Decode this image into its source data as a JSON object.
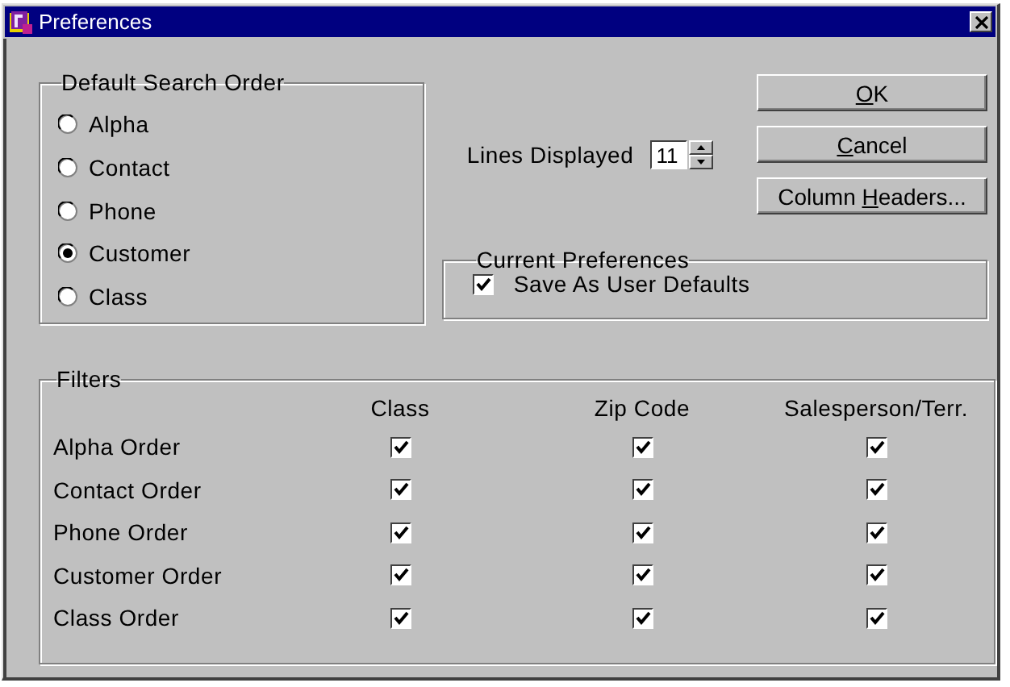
{
  "window": {
    "title": "Preferences"
  },
  "search_order": {
    "label": "Default Search Order",
    "options": [
      {
        "label": "Alpha",
        "selected": false
      },
      {
        "label": "Contact",
        "selected": false
      },
      {
        "label": "Phone",
        "selected": false
      },
      {
        "label": "Customer",
        "selected": true
      },
      {
        "label": "Class",
        "selected": false
      }
    ]
  },
  "lines_displayed": {
    "label": "Lines Displayed",
    "value": "11"
  },
  "buttons": [
    {
      "access_key": "O",
      "text_after": "K"
    },
    {
      "access_key": "C",
      "text_after": "ancel"
    },
    {
      "text_before": "Column ",
      "access_key": "H",
      "text_after": "eaders..."
    }
  ],
  "current_preferences": {
    "label": "Current Preferences",
    "checkbox": {
      "label": "Save As User Defaults",
      "checked": true
    }
  },
  "filters": {
    "label": "Filters",
    "columns": [
      "Class",
      "Zip Code",
      "Salesperson/Terr."
    ],
    "rows": [
      {
        "label": "Alpha Order",
        "checks": [
          true,
          true,
          true
        ]
      },
      {
        "label": "Contact Order",
        "checks": [
          true,
          true,
          true
        ]
      },
      {
        "label": "Phone Order",
        "checks": [
          true,
          true,
          true
        ]
      },
      {
        "label": "Customer Order",
        "checks": [
          true,
          true,
          true
        ]
      },
      {
        "label": "Class Order",
        "checks": [
          true,
          true,
          true
        ]
      }
    ]
  }
}
